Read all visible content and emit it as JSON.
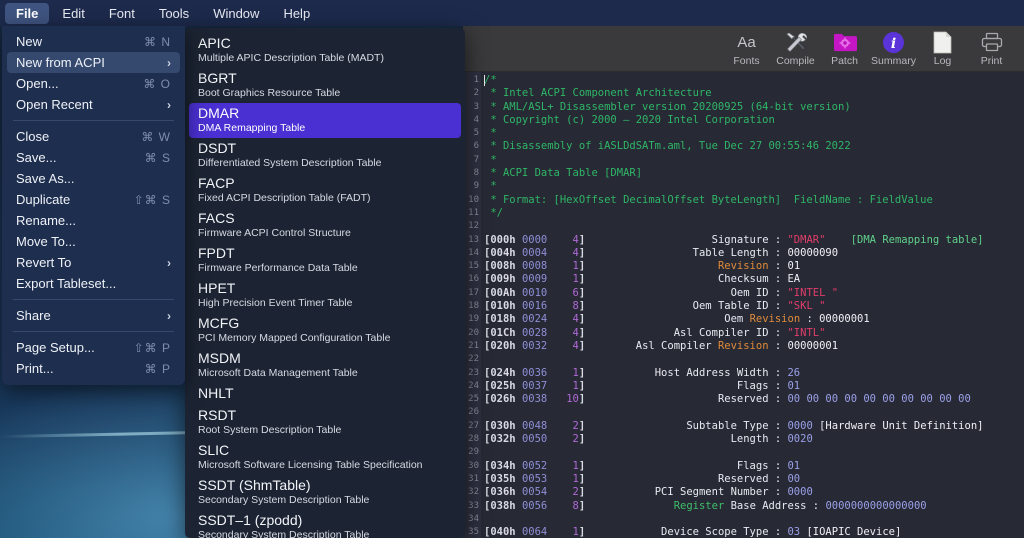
{
  "menubar": {
    "items": [
      {
        "label": "File",
        "active": true
      },
      {
        "label": "Edit",
        "active": false
      },
      {
        "label": "Font",
        "active": false
      },
      {
        "label": "Tools",
        "active": false
      },
      {
        "label": "Window",
        "active": false
      },
      {
        "label": "Help",
        "active": false
      }
    ]
  },
  "file_menu": {
    "groups": [
      [
        {
          "label": "New",
          "shortcut": "⌘ N",
          "arrow": false,
          "selected": false
        },
        {
          "label": "New from ACPI",
          "shortcut": "",
          "arrow": true,
          "selected": true
        },
        {
          "label": "Open...",
          "shortcut": "⌘ O",
          "arrow": false,
          "selected": false
        },
        {
          "label": "Open Recent",
          "shortcut": "",
          "arrow": true,
          "selected": false
        }
      ],
      [
        {
          "label": "Close",
          "shortcut": "⌘ W",
          "arrow": false,
          "selected": false
        },
        {
          "label": "Save...",
          "shortcut": "⌘ S",
          "arrow": false,
          "selected": false
        },
        {
          "label": "Save As...",
          "shortcut": "",
          "arrow": false,
          "selected": false
        },
        {
          "label": "Duplicate",
          "shortcut": "⇧⌘ S",
          "arrow": false,
          "selected": false
        },
        {
          "label": "Rename...",
          "shortcut": "",
          "arrow": false,
          "selected": false
        },
        {
          "label": "Move To...",
          "shortcut": "",
          "arrow": false,
          "selected": false
        },
        {
          "label": "Revert To",
          "shortcut": "",
          "arrow": true,
          "selected": false
        },
        {
          "label": "Export Tableset...",
          "shortcut": "",
          "arrow": false,
          "selected": false
        }
      ],
      [
        {
          "label": "Share",
          "shortcut": "",
          "arrow": true,
          "selected": false
        }
      ],
      [
        {
          "label": "Page Setup...",
          "shortcut": "⇧⌘ P",
          "arrow": false,
          "selected": false
        },
        {
          "label": "Print...",
          "shortcut": "⌘ P",
          "arrow": false,
          "selected": false
        }
      ]
    ]
  },
  "acpi_menu": {
    "highlight_color": "#4a30d2",
    "items": [
      {
        "title": "APIC",
        "subtitle": "Multiple APIC Description Table (MADT)",
        "selected": false
      },
      {
        "title": "BGRT",
        "subtitle": "Boot Graphics Resource Table",
        "selected": false
      },
      {
        "title": "DMAR",
        "subtitle": "DMA Remapping Table",
        "selected": true
      },
      {
        "title": "DSDT",
        "subtitle": "Differentiated System Description Table",
        "selected": false
      },
      {
        "title": "FACP",
        "subtitle": "Fixed ACPI Description Table (FADT)",
        "selected": false
      },
      {
        "title": "FACS",
        "subtitle": "Firmware ACPI Control Structure",
        "selected": false
      },
      {
        "title": "FPDT",
        "subtitle": "Firmware Performance Data Table",
        "selected": false
      },
      {
        "title": "HPET",
        "subtitle": "High Precision Event Timer Table",
        "selected": false
      },
      {
        "title": "MCFG",
        "subtitle": "PCI Memory Mapped Configuration Table",
        "selected": false
      },
      {
        "title": "MSDM",
        "subtitle": "Microsoft Data Management Table",
        "selected": false
      },
      {
        "title": "NHLT",
        "subtitle": "",
        "selected": false
      },
      {
        "title": "RSDT",
        "subtitle": "Root System Description Table",
        "selected": false
      },
      {
        "title": "SLIC",
        "subtitle": "Microsoft Software Licensing Table Specification",
        "selected": false
      },
      {
        "title": "SSDT (ShmTable)",
        "subtitle": "Secondary System Description Table",
        "selected": false
      },
      {
        "title": "SSDT–1 (zpodd)",
        "subtitle": "Secondary System Description Table",
        "selected": false
      }
    ]
  },
  "toolbar": {
    "buttons": [
      {
        "label": "Fonts",
        "icon": "fonts-icon"
      },
      {
        "label": "Compile",
        "icon": "tools-icon"
      },
      {
        "label": "Patch",
        "icon": "patch-folder-icon"
      },
      {
        "label": "Summary",
        "icon": "info-icon"
      },
      {
        "label": "Log",
        "icon": "document-icon"
      },
      {
        "label": "Print",
        "icon": "printer-icon"
      }
    ]
  },
  "editor": {
    "line_count": 35,
    "lines": [
      [
        {
          "t": "/*",
          "c": "c-cmt"
        }
      ],
      [
        {
          "t": " * Intel ACPI Component Architecture",
          "c": "c-cmt"
        }
      ],
      [
        {
          "t": " * AML/ASL+ Disassembler version 20200925 (64-bit version)",
          "c": "c-cmt"
        }
      ],
      [
        {
          "t": " * Copyright (c) 2000 – 2020 Intel Corporation",
          "c": "c-cmt"
        }
      ],
      [
        {
          "t": " *",
          "c": "c-cmt"
        }
      ],
      [
        {
          "t": " * Disassembly of iASLDdSATm.aml, Tue Dec 27 00:55:46 2022",
          "c": "c-cmt"
        }
      ],
      [
        {
          "t": " *",
          "c": "c-cmt"
        }
      ],
      [
        {
          "t": " * ACPI Data Table [DMAR]",
          "c": "c-cmt"
        }
      ],
      [
        {
          "t": " *",
          "c": "c-cmt"
        }
      ],
      [
        {
          "t": " * Format: [HexOffset DecimalOffset ByteLength]  FieldName : FieldValue",
          "c": "c-cmt"
        }
      ],
      [
        {
          "t": " */",
          "c": "c-cmt"
        }
      ],
      [
        {
          "t": "",
          "c": "c-val"
        }
      ],
      [
        {
          "t": "[000h ",
          "c": "c-off"
        },
        {
          "t": "0000",
          "c": "c-dec"
        },
        {
          "t": "    ",
          "c": "c-off"
        },
        {
          "t": "4",
          "c": "c-len"
        },
        {
          "t": "]",
          "c": "c-off"
        },
        {
          "t": "                    Signature : ",
          "c": "c-fld"
        },
        {
          "t": "\"DMAR\"",
          "c": "c-str"
        },
        {
          "t": "    ",
          "c": "c-fld"
        },
        {
          "t": "[DMA Remapping table]",
          "c": "c-note"
        }
      ],
      [
        {
          "t": "[004h ",
          "c": "c-off"
        },
        {
          "t": "0004",
          "c": "c-dec"
        },
        {
          "t": "    ",
          "c": "c-off"
        },
        {
          "t": "4",
          "c": "c-len"
        },
        {
          "t": "]",
          "c": "c-off"
        },
        {
          "t": "                 Table Length : ",
          "c": "c-fld"
        },
        {
          "t": "00000090",
          "c": "c-white"
        }
      ],
      [
        {
          "t": "[008h ",
          "c": "c-off"
        },
        {
          "t": "0008",
          "c": "c-dec"
        },
        {
          "t": "    ",
          "c": "c-off"
        },
        {
          "t": "1",
          "c": "c-len"
        },
        {
          "t": "]",
          "c": "c-off"
        },
        {
          "t": "                     ",
          "c": "c-fld"
        },
        {
          "t": "Revision",
          "c": "c-kw"
        },
        {
          "t": " : ",
          "c": "c-fld"
        },
        {
          "t": "01",
          "c": "c-white"
        }
      ],
      [
        {
          "t": "[009h ",
          "c": "c-off"
        },
        {
          "t": "0009",
          "c": "c-dec"
        },
        {
          "t": "    ",
          "c": "c-off"
        },
        {
          "t": "1",
          "c": "c-len"
        },
        {
          "t": "]",
          "c": "c-off"
        },
        {
          "t": "                     Checksum : ",
          "c": "c-fld"
        },
        {
          "t": "EA",
          "c": "c-white"
        }
      ],
      [
        {
          "t": "[00Ah ",
          "c": "c-off"
        },
        {
          "t": "0010",
          "c": "c-dec"
        },
        {
          "t": "    ",
          "c": "c-off"
        },
        {
          "t": "6",
          "c": "c-len"
        },
        {
          "t": "]",
          "c": "c-off"
        },
        {
          "t": "                       Oem ID : ",
          "c": "c-fld"
        },
        {
          "t": "\"INTEL \"",
          "c": "c-str"
        }
      ],
      [
        {
          "t": "[010h ",
          "c": "c-off"
        },
        {
          "t": "0016",
          "c": "c-dec"
        },
        {
          "t": "    ",
          "c": "c-off"
        },
        {
          "t": "8",
          "c": "c-len"
        },
        {
          "t": "]",
          "c": "c-off"
        },
        {
          "t": "                 Oem Table ID : ",
          "c": "c-fld"
        },
        {
          "t": "\"SKL \"",
          "c": "c-str"
        }
      ],
      [
        {
          "t": "[018h ",
          "c": "c-off"
        },
        {
          "t": "0024",
          "c": "c-dec"
        },
        {
          "t": "    ",
          "c": "c-off"
        },
        {
          "t": "4",
          "c": "c-len"
        },
        {
          "t": "]",
          "c": "c-off"
        },
        {
          "t": "                      Oem ",
          "c": "c-fld"
        },
        {
          "t": "Revision",
          "c": "c-kw"
        },
        {
          "t": " : ",
          "c": "c-fld"
        },
        {
          "t": "00000001",
          "c": "c-white"
        }
      ],
      [
        {
          "t": "[01Ch ",
          "c": "c-off"
        },
        {
          "t": "0028",
          "c": "c-dec"
        },
        {
          "t": "    ",
          "c": "c-off"
        },
        {
          "t": "4",
          "c": "c-len"
        },
        {
          "t": "]",
          "c": "c-off"
        },
        {
          "t": "              Asl Compiler ID : ",
          "c": "c-fld"
        },
        {
          "t": "\"INTL\"",
          "c": "c-str"
        }
      ],
      [
        {
          "t": "[020h ",
          "c": "c-off"
        },
        {
          "t": "0032",
          "c": "c-dec"
        },
        {
          "t": "    ",
          "c": "c-off"
        },
        {
          "t": "4",
          "c": "c-len"
        },
        {
          "t": "]",
          "c": "c-off"
        },
        {
          "t": "        Asl Compiler ",
          "c": "c-fld"
        },
        {
          "t": "Revision",
          "c": "c-kw"
        },
        {
          "t": " : ",
          "c": "c-fld"
        },
        {
          "t": "00000001",
          "c": "c-white"
        }
      ],
      [
        {
          "t": "",
          "c": "c-val"
        }
      ],
      [
        {
          "t": "[024h ",
          "c": "c-off"
        },
        {
          "t": "0036",
          "c": "c-dec"
        },
        {
          "t": "    ",
          "c": "c-off"
        },
        {
          "t": "1",
          "c": "c-len"
        },
        {
          "t": "]",
          "c": "c-off"
        },
        {
          "t": "           Host Address Width : ",
          "c": "c-fld"
        },
        {
          "t": "26",
          "c": "c-num"
        }
      ],
      [
        {
          "t": "[025h ",
          "c": "c-off"
        },
        {
          "t": "0037",
          "c": "c-dec"
        },
        {
          "t": "    ",
          "c": "c-off"
        },
        {
          "t": "1",
          "c": "c-len"
        },
        {
          "t": "]",
          "c": "c-off"
        },
        {
          "t": "                        Flags : ",
          "c": "c-fld"
        },
        {
          "t": "01",
          "c": "c-num"
        }
      ],
      [
        {
          "t": "[026h ",
          "c": "c-off"
        },
        {
          "t": "0038",
          "c": "c-dec"
        },
        {
          "t": "   ",
          "c": "c-off"
        },
        {
          "t": "10",
          "c": "c-len"
        },
        {
          "t": "]",
          "c": "c-off"
        },
        {
          "t": "                     Reserved : ",
          "c": "c-fld"
        },
        {
          "t": "00 00 00 00 00 00 00 00 00 00",
          "c": "c-num"
        }
      ],
      [
        {
          "t": "",
          "c": "c-val"
        }
      ],
      [
        {
          "t": "[030h ",
          "c": "c-off"
        },
        {
          "t": "0048",
          "c": "c-dec"
        },
        {
          "t": "    ",
          "c": "c-off"
        },
        {
          "t": "2",
          "c": "c-len"
        },
        {
          "t": "]",
          "c": "c-off"
        },
        {
          "t": "                Subtable Type : ",
          "c": "c-fld"
        },
        {
          "t": "0000",
          "c": "c-num"
        },
        {
          "t": " [Hardware Unit Definition]",
          "c": "c-white"
        }
      ],
      [
        {
          "t": "[032h ",
          "c": "c-off"
        },
        {
          "t": "0050",
          "c": "c-dec"
        },
        {
          "t": "    ",
          "c": "c-off"
        },
        {
          "t": "2",
          "c": "c-len"
        },
        {
          "t": "]",
          "c": "c-off"
        },
        {
          "t": "                       Length : ",
          "c": "c-fld"
        },
        {
          "t": "0020",
          "c": "c-num"
        }
      ],
      [
        {
          "t": "",
          "c": "c-val"
        }
      ],
      [
        {
          "t": "[034h ",
          "c": "c-off"
        },
        {
          "t": "0052",
          "c": "c-dec"
        },
        {
          "t": "    ",
          "c": "c-off"
        },
        {
          "t": "1",
          "c": "c-len"
        },
        {
          "t": "]",
          "c": "c-off"
        },
        {
          "t": "                        Flags : ",
          "c": "c-fld"
        },
        {
          "t": "01",
          "c": "c-num"
        }
      ],
      [
        {
          "t": "[035h ",
          "c": "c-off"
        },
        {
          "t": "0053",
          "c": "c-dec"
        },
        {
          "t": "    ",
          "c": "c-off"
        },
        {
          "t": "1",
          "c": "c-len"
        },
        {
          "t": "]",
          "c": "c-off"
        },
        {
          "t": "                     Reserved : ",
          "c": "c-fld"
        },
        {
          "t": "00",
          "c": "c-num"
        }
      ],
      [
        {
          "t": "[036h ",
          "c": "c-off"
        },
        {
          "t": "0054",
          "c": "c-dec"
        },
        {
          "t": "    ",
          "c": "c-off"
        },
        {
          "t": "2",
          "c": "c-len"
        },
        {
          "t": "]",
          "c": "c-off"
        },
        {
          "t": "           PCI Segment Number : ",
          "c": "c-fld"
        },
        {
          "t": "0000",
          "c": "c-num"
        }
      ],
      [
        {
          "t": "[038h ",
          "c": "c-off"
        },
        {
          "t": "0056",
          "c": "c-dec"
        },
        {
          "t": "    ",
          "c": "c-off"
        },
        {
          "t": "8",
          "c": "c-len"
        },
        {
          "t": "]",
          "c": "c-off"
        },
        {
          "t": "              ",
          "c": "c-fld"
        },
        {
          "t": "Register",
          "c": "c-grn"
        },
        {
          "t": " Base Address : ",
          "c": "c-fld"
        },
        {
          "t": "0000000000000000",
          "c": "c-num"
        }
      ],
      [
        {
          "t": "",
          "c": "c-val"
        }
      ],
      [
        {
          "t": "[040h ",
          "c": "c-off"
        },
        {
          "t": "0064",
          "c": "c-dec"
        },
        {
          "t": "    ",
          "c": "c-off"
        },
        {
          "t": "1",
          "c": "c-len"
        },
        {
          "t": "]",
          "c": "c-off"
        },
        {
          "t": "            Device Scope Type : ",
          "c": "c-fld"
        },
        {
          "t": "03",
          "c": "c-num"
        },
        {
          "t": " [IOAPIC Device]",
          "c": "c-white"
        }
      ]
    ]
  }
}
